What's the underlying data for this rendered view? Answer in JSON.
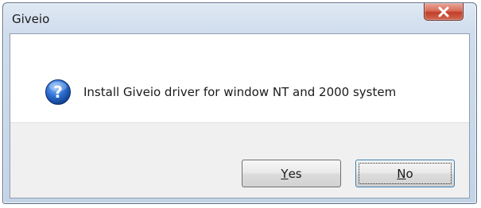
{
  "window": {
    "title": "Giveio",
    "close_glyph": "x"
  },
  "message": {
    "icon": "question-icon",
    "text": "Install Giveio driver for window NT and 2000 system"
  },
  "buttons": {
    "yes": {
      "mnemonic": "Y",
      "rest": "es"
    },
    "no": {
      "mnemonic": "N",
      "rest": "o"
    }
  },
  "colors": {
    "close_button": "#c2402a",
    "icon_blue": "#1f5fb8",
    "focus_border": "#3c7fb1"
  }
}
